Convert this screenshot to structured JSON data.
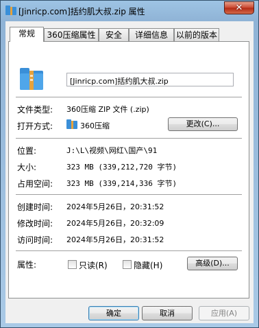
{
  "window": {
    "title": "[Jinricp.com]括约肌大叔.zip 属性",
    "close_label": "✕"
  },
  "tabs": [
    {
      "label": "常规",
      "active": true
    },
    {
      "label": "360压缩属性"
    },
    {
      "label": "安全"
    },
    {
      "label": "详细信息"
    },
    {
      "label": "以前的版本"
    }
  ],
  "general": {
    "filename": "[Jinricp.com]括约肌大叔.zip",
    "file_type_label": "文件类型:",
    "file_type_value": "360压缩 ZIP 文件 (.zip)",
    "open_with_label": "打开方式:",
    "open_with_value": "360压缩",
    "change_button": "更改(C)...",
    "location_label": "位置:",
    "location_value": "J:\\L\\视频\\网红\\国产\\91",
    "size_label": "大小:",
    "size_value": "323 MB (339,212,720 字节)",
    "size_on_disk_label": "占用空间:",
    "size_on_disk_value": "323 MB (339,214,336 字节)",
    "created_label": "创建时间:",
    "created_value": "2024年5月26日，20:31:52",
    "modified_label": "修改时间:",
    "modified_value": "2024年5月26日，20:32:09",
    "accessed_label": "访问时间:",
    "accessed_value": "2024年5月26日，20:31:52",
    "attributes_label": "属性:",
    "readonly_label": "只读(R)",
    "hidden_label": "隐藏(H)",
    "advanced_button": "高级(D)..."
  },
  "footer": {
    "ok_button": "确定",
    "cancel_button": "取消",
    "apply_button": "应用(A)"
  },
  "icons": {
    "title": "zip-archive-icon",
    "file": "zip-archive-icon",
    "open_with": "360zip-app-icon"
  },
  "colors": {
    "title_bar": "#8fb3d6",
    "close_button": "#c8452e",
    "client": "#f0f0f0",
    "panel": "#ffffff",
    "default_button_border": "#3c7fb1"
  }
}
